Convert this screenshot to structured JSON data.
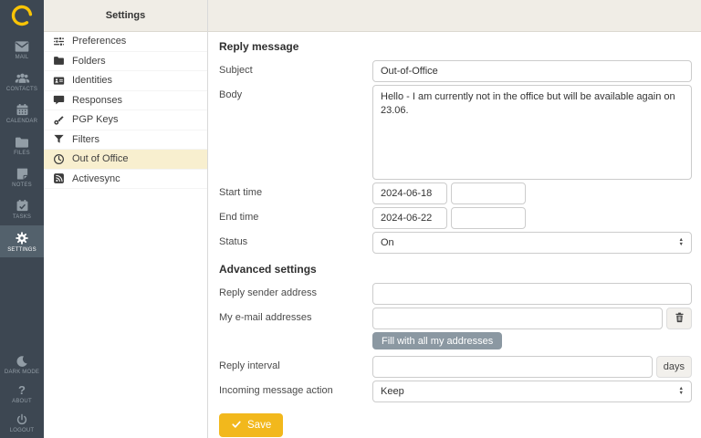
{
  "colors": {
    "accent_yellow": "#f2b81c",
    "logo_yellow": "#f9c406",
    "sidebar_bg": "#3d4752",
    "sidebar_selected_bg": "#53616c",
    "header_bg": "#f0ede6",
    "selected_row_bg": "#f8efcf",
    "secondary_button_bg": "#8b98a2"
  },
  "taskmenu": {
    "items": [
      {
        "label": "MAIL",
        "icon": "envelope-icon"
      },
      {
        "label": "CONTACTS",
        "icon": "people-icon"
      },
      {
        "label": "CALENDAR",
        "icon": "calendar-icon"
      },
      {
        "label": "FILES",
        "icon": "folder-icon"
      },
      {
        "label": "NOTES",
        "icon": "note-icon"
      },
      {
        "label": "TASKS",
        "icon": "task-calendar-icon"
      },
      {
        "label": "SETTINGS",
        "icon": "gear-icon",
        "selected": true
      }
    ],
    "bottom": [
      {
        "label": "DARK MODE",
        "icon": "moon-icon"
      },
      {
        "label": "ABOUT",
        "icon": "question-icon"
      },
      {
        "label": "LOGOUT",
        "icon": "power-icon"
      }
    ]
  },
  "settings_list": {
    "title": "Settings",
    "items": [
      {
        "label": "Preferences",
        "icon": "sliders-icon"
      },
      {
        "label": "Folders",
        "icon": "folder-icon"
      },
      {
        "label": "Identities",
        "icon": "id-card-icon"
      },
      {
        "label": "Responses",
        "icon": "speech-bubble-icon"
      },
      {
        "label": "PGP Keys",
        "icon": "key-icon"
      },
      {
        "label": "Filters",
        "icon": "funnel-icon"
      },
      {
        "label": "Out of Office",
        "icon": "clock-icon",
        "selected": true
      },
      {
        "label": "Activesync",
        "icon": "broadcast-icon"
      }
    ]
  },
  "form": {
    "reply_title": "Reply message",
    "subject": {
      "label": "Subject",
      "value": "Out-of-Office"
    },
    "body": {
      "label": "Body",
      "value": "Hello - I am currently not in the office but will be available again on 23.06."
    },
    "start": {
      "label": "Start time",
      "date": "2024-06-18",
      "time": ""
    },
    "end": {
      "label": "End time",
      "date": "2024-06-22",
      "time": ""
    },
    "status": {
      "label": "Status",
      "value": "On"
    },
    "advanced_title": "Advanced settings",
    "reply_sender": {
      "label": "Reply sender address",
      "value": ""
    },
    "my_addresses": {
      "label": "My e-mail addresses",
      "value": "",
      "fill_button_label": "Fill with all my addresses"
    },
    "reply_interval": {
      "label": "Reply interval",
      "value": "",
      "suffix": "days"
    },
    "incoming_action": {
      "label": "Incoming message action",
      "value": "Keep"
    },
    "save_label": "Save"
  }
}
